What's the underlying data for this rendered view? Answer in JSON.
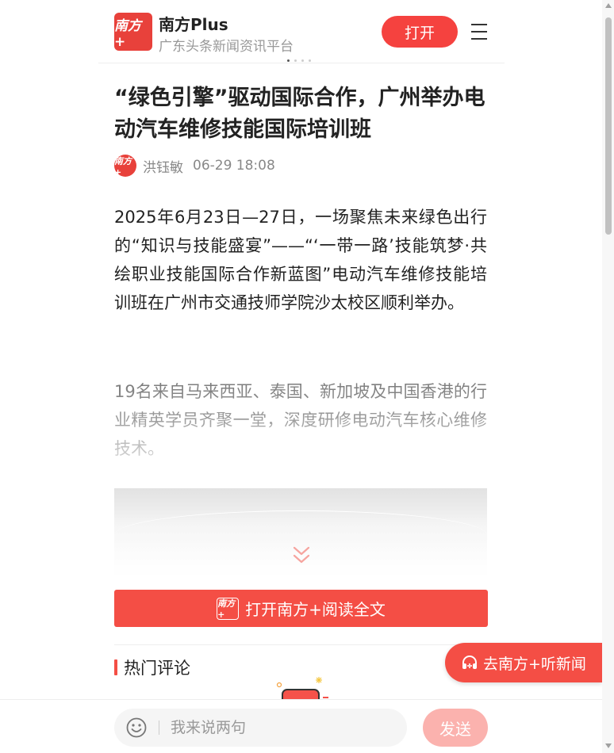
{
  "header": {
    "logo_text": "南方+",
    "brand_name": "南方Plus",
    "brand_sub": "广东头条新闻资讯平台",
    "open_label": "打开",
    "menu_icon": "hamburger-menu-icon"
  },
  "article": {
    "title": "“绿色引擎”驱动国际合作，广州举办电动汽车维修技能国际培训班",
    "author_avatar_text": "南方+",
    "author": "洪钰敏",
    "date": "06-29 18:08",
    "paragraphs": [
      "2025年6月23日—27日，一场聚焦未来绿色出行的“知识与技能盛宴”——“‘一带一路’技能筑梦·共绘职业技能国际合作新蓝图”电动汽车维修技能培训班在广州市交通技师学院沙太校区顺利举办。",
      "19名来自马来西亚、泰国、新加坡及中国香港的行业精英学员齐聚一堂，深度研修电动汽车核心维修技术。"
    ],
    "expand_icon": "double-chevron-down-icon"
  },
  "read_full": {
    "logo_text": "南方+",
    "label": "打开南方+阅读全文"
  },
  "comments": {
    "title": "热门评论"
  },
  "listen": {
    "icon": "headphones-icon",
    "label": "去南方+听新闻"
  },
  "bottom_bar": {
    "smile_icon": "smile-icon",
    "input_placeholder": "我来说两句",
    "send_label": "发送"
  },
  "colors": {
    "brand_red": "#f5423f",
    "send_disabled": "#fbb2ae",
    "muted_text": "#888888"
  }
}
